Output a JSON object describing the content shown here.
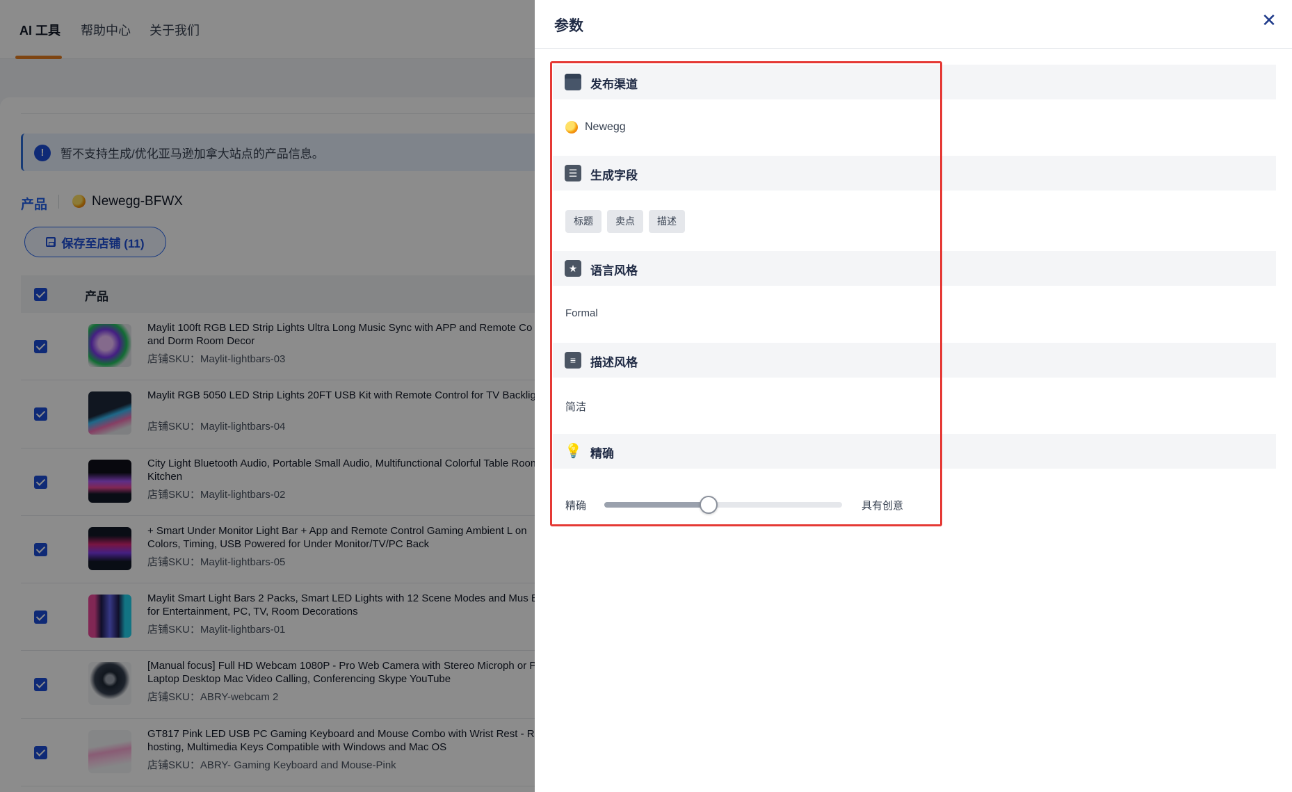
{
  "nav": {
    "tabs": [
      {
        "label": "AI 工具"
      },
      {
        "label": "帮助中心"
      },
      {
        "label": "关于我们"
      }
    ]
  },
  "notice": {
    "text": "暂不支持生成/优化亚马逊加拿大站点的产品信息。"
  },
  "product_header": {
    "label": "产品",
    "channel_name": "Newegg-BFWX"
  },
  "save_button": {
    "label": "保存至店铺 (11)"
  },
  "table": {
    "header": "产品",
    "rows": [
      {
        "title": "Maylit 100ft RGB LED Strip Lights Ultra Long Music Sync with APP and Remote Co and Dorm Room Decor",
        "sku": "店铺SKU：Maylit-lightbars-03"
      },
      {
        "title": "Maylit RGB 5050 LED Strip Lights 20FT USB Kit with Remote Control for TV Backlig",
        "sku": "店铺SKU：Maylit-lightbars-04"
      },
      {
        "title": "City Light Bluetooth Audio, Portable Small Audio, Multifunctional Colorful Table Room & Kitchen",
        "sku": "店铺SKU：Maylit-lightbars-02"
      },
      {
        "title": "+ Smart Under Monitor Light Bar + App and Remote Control Gaming Ambient L on Colors, Timing, USB Powered for Under Monitor/TV/PC Back",
        "sku": "店铺SKU：Maylit-lightbars-05"
      },
      {
        "title": "Maylit Smart Light Bars 2 Packs, Smart LED Lights with 12 Scene Modes and Mus Bar for Entertainment, PC, TV, Room Decorations",
        "sku": "店铺SKU：Maylit-lightbars-01"
      },
      {
        "title": "[Manual focus] Full HD Webcam 1080P - Pro Web Camera with Stereo Microph or PC Laptop Desktop Mac Video Calling, Conferencing Skype YouTube",
        "sku": "店铺SKU：ABRY-webcam 2"
      },
      {
        "title": "GT817 Pink LED USB PC Gaming Keyboard and Mouse Combo with Wrist Rest - R hosting, Multimedia Keys Compatible with Windows and Mac OS",
        "sku": "店铺SKU：ABRY- Gaming Keyboard and Mouse-Pink"
      }
    ]
  },
  "drawer": {
    "title": "参数",
    "close_icon": "close-icon",
    "sections": {
      "channel": {
        "title": "发布渠道",
        "value": "Newegg"
      },
      "fields": {
        "title": "生成字段",
        "chips": [
          "标题",
          "卖点",
          "描述"
        ]
      },
      "language_style": {
        "title": "语言风格",
        "value": "Formal"
      },
      "description_style": {
        "title": "描述风格",
        "value": "简洁"
      },
      "precision": {
        "title": "精确",
        "left_label": "精确",
        "right_label": "具有创意",
        "level": 0.44
      }
    }
  },
  "colors": {
    "accent": "#1d4ed8",
    "nav_underline": "#e67e22",
    "highlight": "#e53935"
  }
}
